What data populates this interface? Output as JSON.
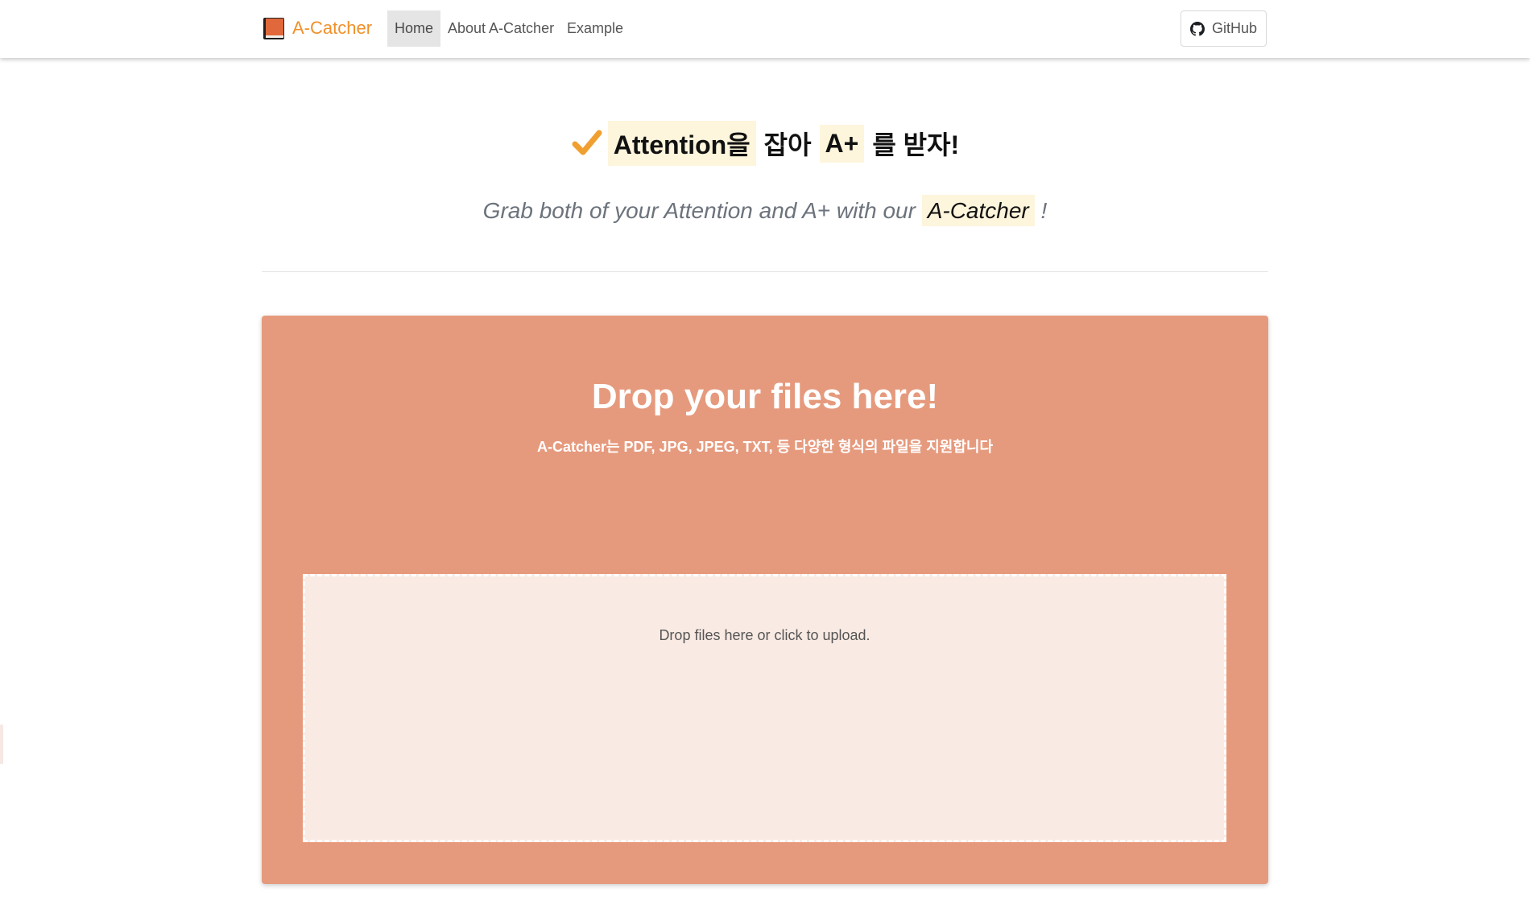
{
  "navbar": {
    "brand": "A-Catcher",
    "links": [
      {
        "label": "Home",
        "active": true
      },
      {
        "label": "About A-Catcher"
      },
      {
        "label": "Example"
      }
    ],
    "github_label": "GitHub"
  },
  "hero": {
    "check_icon": "check-mark-icon",
    "headline": {
      "part1": "Attention을",
      "part2": "잡아",
      "part3": "A+",
      "part4": "를 받자!"
    },
    "subtitle": {
      "prefix": "Grab both of your Attention and A+ with our",
      "highlight": "A-Catcher",
      "suffix": "!"
    }
  },
  "upload": {
    "title": "Drop your files here!",
    "subtitle": "A-Catcher는 PDF, JPG, JPEG, TXT, 등 다양한 형식의 파일을 지원합니다",
    "dropzone_message": "Drop files here or click to upload."
  },
  "colors": {
    "brand": "#f0902a",
    "highlight_bg": "#fdf5dc",
    "card_bg": "#e69a7d",
    "dropzone_bg": "#f9eae3"
  }
}
